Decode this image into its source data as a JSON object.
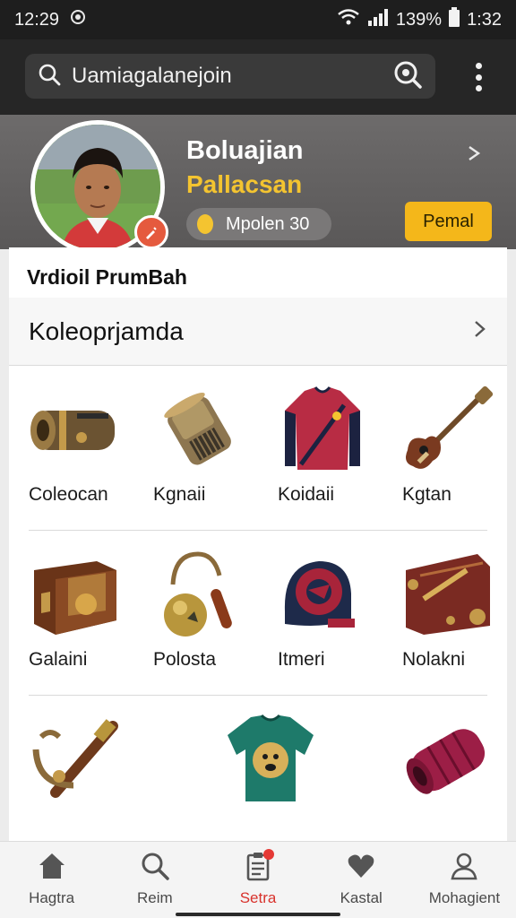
{
  "status_bar": {
    "time": "12:29",
    "battery": "139%",
    "clock_right": "1:32",
    "icons": [
      "wifi-icon",
      "signal-icon",
      "battery-icon",
      "notification-icon"
    ]
  },
  "search": {
    "query": "Uamiagalanejoin",
    "icons": [
      "search-icon",
      "lens-icon",
      "more-vertical-icon"
    ]
  },
  "profile": {
    "name": "Boluajian",
    "subtitle": "Pallacsan",
    "coins_label": "Mpolen 30",
    "action_button": "Pemal",
    "icons": [
      "coin-icon",
      "chevron-right-icon",
      "edit-badge-icon"
    ]
  },
  "content": {
    "section_title": "Vrdioil PrumBah",
    "collection_label": "Koleoprjamda",
    "items": [
      {
        "name": "Coleocan",
        "icon": "bronze-cylinder-icon"
      },
      {
        "name": "Kgnaii",
        "icon": "grate-canister-icon"
      },
      {
        "name": "Koidaii",
        "icon": "red-jersey-icon"
      },
      {
        "name": "Kgtan",
        "icon": "guitar-icon"
      },
      {
        "name": "Galaini",
        "icon": "wooden-chest-icon"
      },
      {
        "name": "Polosta",
        "icon": "bell-whistle-icon"
      },
      {
        "name": "Itmeri",
        "icon": "helmet-icon"
      },
      {
        "name": "Nolakni",
        "icon": "leather-bag-icon"
      },
      {
        "name": "",
        "icon": "anchor-cannon-icon"
      },
      {
        "name": "",
        "icon": "teal-shirt-icon"
      },
      {
        "name": "",
        "icon": "maroon-cylinder-icon"
      }
    ]
  },
  "bottom_nav": [
    {
      "label": "Hagtra",
      "icon": "home-icon"
    },
    {
      "label": "Reim",
      "icon": "search-icon"
    },
    {
      "label": "Setra",
      "icon": "clipboard-icon"
    },
    {
      "label": "Kastal",
      "icon": "heart-icon"
    },
    {
      "label": "Mohagient",
      "icon": "person-icon"
    }
  ],
  "colors": {
    "accent_yellow": "#f4b71a",
    "accent_red": "#d8322c",
    "header_dark": "#262626"
  }
}
